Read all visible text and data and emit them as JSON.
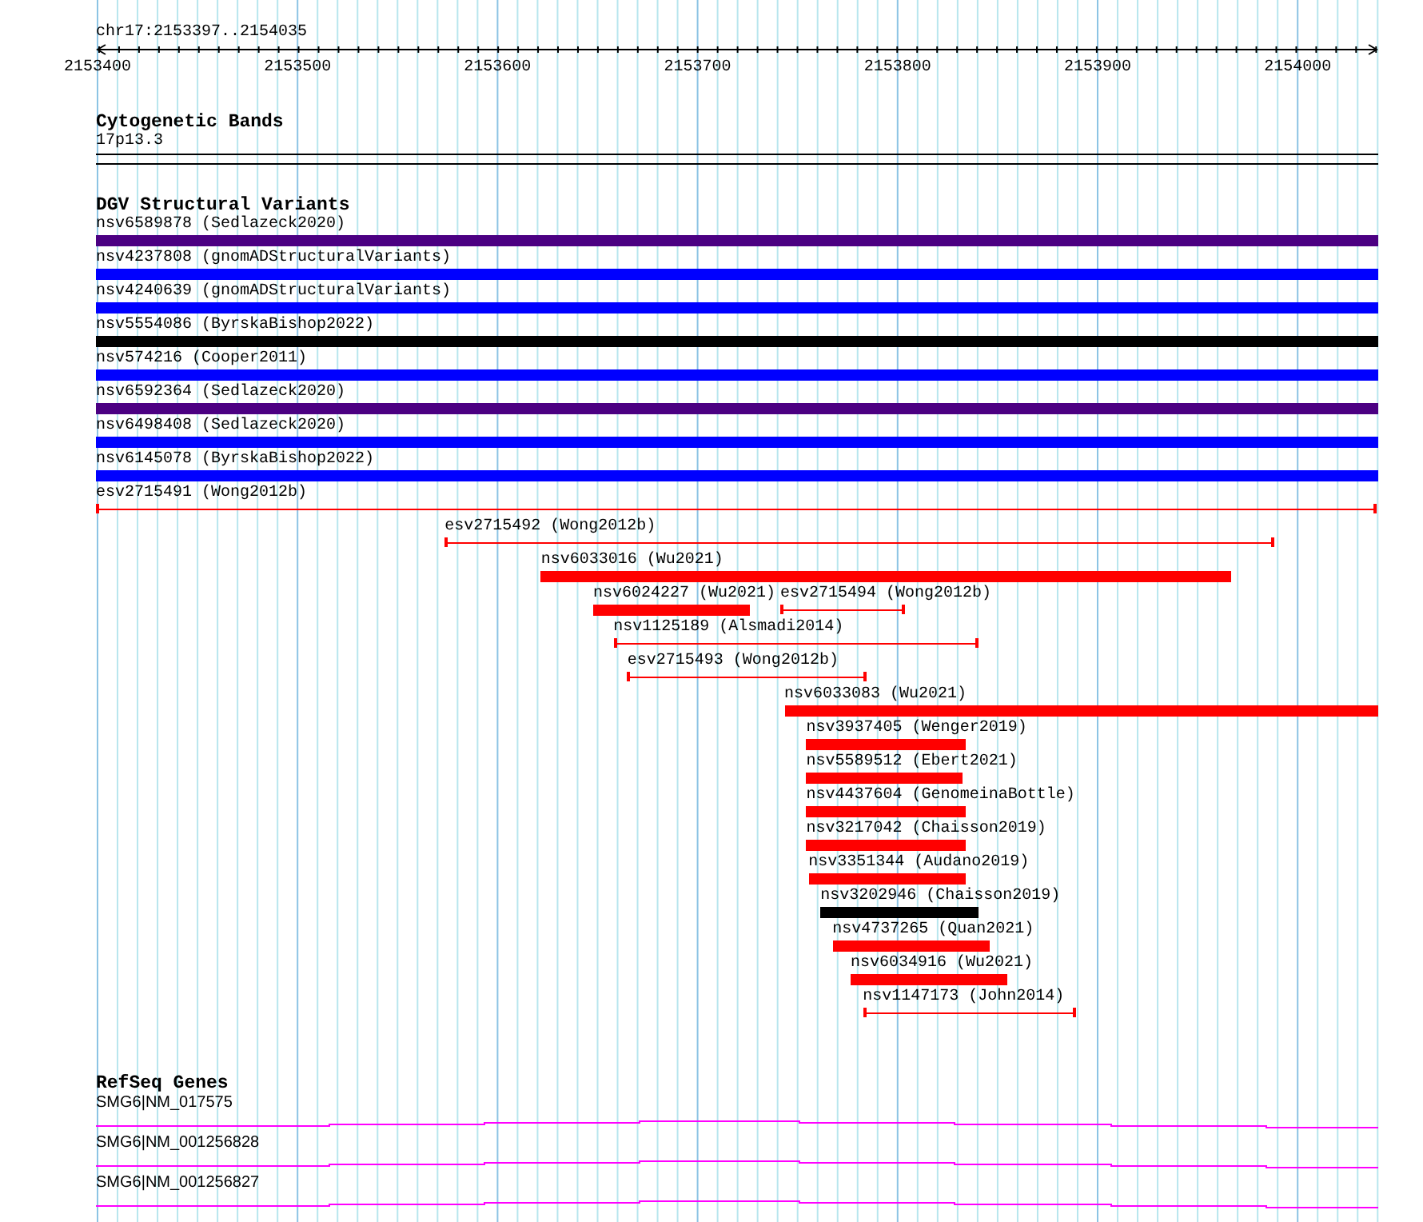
{
  "ruler": {
    "location": "chr17:2153397..2154035",
    "ticks": [
      "2153400",
      "2153500",
      "2153600",
      "2153700",
      "2153800",
      "2153900",
      "2154000"
    ]
  },
  "cytoband": {
    "title": "Cytogenetic Bands",
    "band": "17p13.3"
  },
  "dgv": {
    "title": "DGV Structural Variants",
    "rows": [
      {
        "features": [
          {
            "label": "nsv6589878 (Sedlazeck2020)",
            "kind": "bar",
            "color": "#4b0082"
          }
        ]
      },
      {
        "features": [
          {
            "label": "nsv4237808 (gnomADStructuralVariants)",
            "kind": "bar",
            "color": "#0000ff"
          }
        ]
      },
      {
        "features": [
          {
            "label": "nsv4240639 (gnomADStructuralVariants)",
            "kind": "bar",
            "color": "#0000ff"
          }
        ]
      },
      {
        "features": [
          {
            "label": "nsv5554086 (ByrskaBishop2022)",
            "kind": "bar",
            "color": "#000000"
          }
        ]
      },
      {
        "features": [
          {
            "label": "nsv574216 (Cooper2011)",
            "kind": "bar",
            "color": "#0000ff"
          }
        ]
      },
      {
        "features": [
          {
            "label": "nsv6592364 (Sedlazeck2020)",
            "kind": "bar",
            "color": "#4b0082"
          }
        ]
      },
      {
        "features": [
          {
            "label": "nsv6498408 (Sedlazeck2020)",
            "kind": "bar",
            "color": "#0000ff"
          }
        ]
      },
      {
        "features": [
          {
            "label": "nsv6145078 (ByrskaBishop2022)",
            "kind": "bar",
            "color": "#0000ff"
          }
        ]
      },
      {
        "features": [
          {
            "label": "esv2715491 (Wong2012b)",
            "kind": "interval",
            "color": "#ff0000"
          }
        ]
      },
      {
        "features": [
          {
            "label": "esv2715492 (Wong2012b)",
            "kind": "interval",
            "color": "#ff0000"
          }
        ]
      },
      {
        "features": [
          {
            "label": "nsv6033016 (Wu2021)",
            "kind": "bar",
            "color": "#ff0000"
          }
        ]
      },
      {
        "features": [
          {
            "label": "nsv6024227 (Wu2021)",
            "kind": "bar",
            "color": "#ff0000"
          },
          {
            "label": "esv2715494 (Wong2012b)",
            "kind": "interval",
            "color": "#ff0000"
          }
        ]
      },
      {
        "features": [
          {
            "label": "nsv1125189 (Alsmadi2014)",
            "kind": "interval",
            "color": "#ff0000"
          }
        ]
      },
      {
        "features": [
          {
            "label": "esv2715493 (Wong2012b)",
            "kind": "interval",
            "color": "#ff0000"
          }
        ]
      },
      {
        "features": [
          {
            "label": "nsv6033083 (Wu2021)",
            "kind": "bar",
            "color": "#ff0000"
          }
        ]
      },
      {
        "features": [
          {
            "label": "nsv3937405 (Wenger2019)",
            "kind": "bar",
            "color": "#ff0000"
          }
        ]
      },
      {
        "features": [
          {
            "label": "nsv5589512 (Ebert2021)",
            "kind": "bar",
            "color": "#ff0000"
          }
        ]
      },
      {
        "features": [
          {
            "label": "nsv4437604 (GenomeinaBottle)",
            "kind": "bar",
            "color": "#ff0000"
          }
        ]
      },
      {
        "features": [
          {
            "label": "nsv3217042 (Chaisson2019)",
            "kind": "bar",
            "color": "#ff0000"
          }
        ]
      },
      {
        "features": [
          {
            "label": "nsv3351344 (Audano2019)",
            "kind": "bar",
            "color": "#ff0000"
          }
        ]
      },
      {
        "features": [
          {
            "label": "nsv3202946 (Chaisson2019)",
            "kind": "bar",
            "color": "#000000"
          }
        ]
      },
      {
        "features": [
          {
            "label": "nsv4737265 (Quan2021)",
            "kind": "bar",
            "color": "#ff0000"
          }
        ]
      },
      {
        "features": [
          {
            "label": "nsv6034916 (Wu2021)",
            "kind": "bar",
            "color": "#ff0000"
          }
        ]
      },
      {
        "features": [
          {
            "label": "nsv1147173 (John2014)",
            "kind": "interval",
            "color": "#ff0000"
          }
        ]
      }
    ]
  },
  "refseq": {
    "title": "RefSeq Genes",
    "genes": [
      {
        "label": "SMG6|NM_017575"
      },
      {
        "label": "SMG6|NM_001256828"
      },
      {
        "label": "SMG6|NM_001256827"
      }
    ]
  }
}
